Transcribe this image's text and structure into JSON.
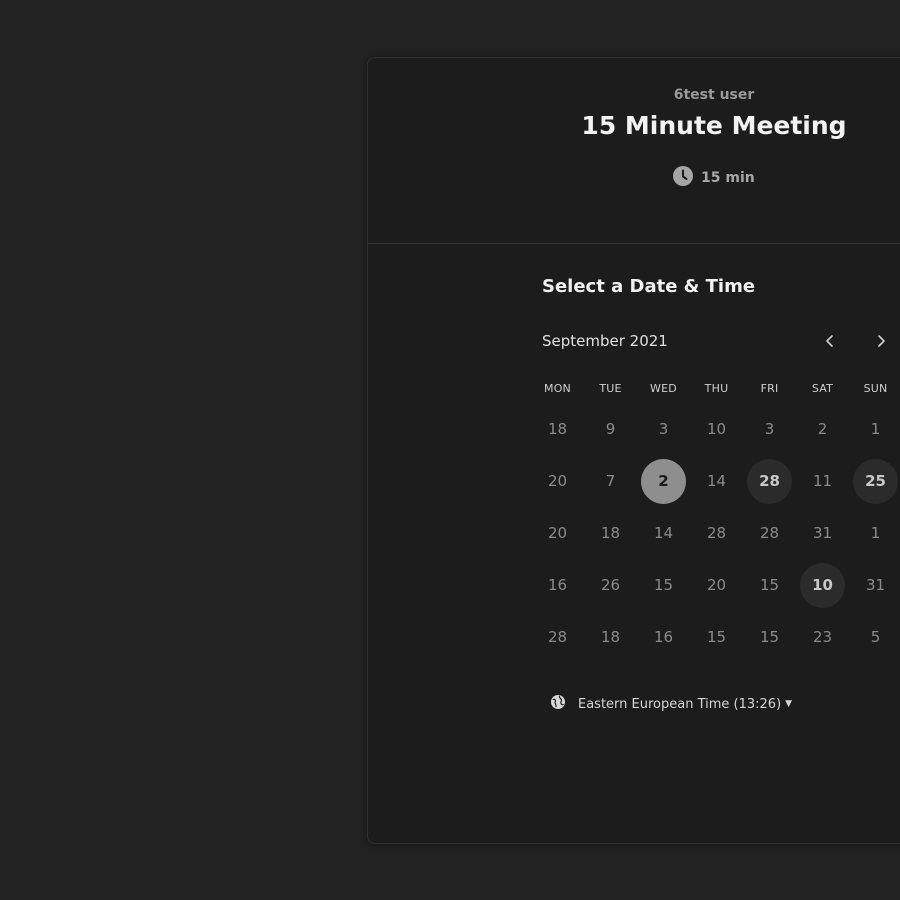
{
  "header": {
    "org_name": "6test user",
    "event_title": "15 Minute Meeting",
    "duration": "15 min"
  },
  "calendar": {
    "section_title": "Select a Date & Time",
    "month_label": "September 2021",
    "weekdays": [
      "MON",
      "TUE",
      "WED",
      "THU",
      "FRI",
      "SAT",
      "SUN"
    ],
    "days": [
      {
        "label": "18",
        "state": "unavailable"
      },
      {
        "label": "9",
        "state": "unavailable"
      },
      {
        "label": "3",
        "state": "unavailable"
      },
      {
        "label": "10",
        "state": "unavailable"
      },
      {
        "label": "3",
        "state": "unavailable"
      },
      {
        "label": "2",
        "state": "unavailable"
      },
      {
        "label": "1",
        "state": "unavailable"
      },
      {
        "label": "20",
        "state": "unavailable"
      },
      {
        "label": "7",
        "state": "unavailable"
      },
      {
        "label": "2",
        "state": "selected"
      },
      {
        "label": "14",
        "state": "unavailable"
      },
      {
        "label": "28",
        "state": "available"
      },
      {
        "label": "11",
        "state": "unavailable"
      },
      {
        "label": "25",
        "state": "available"
      },
      {
        "label": "20",
        "state": "unavailable"
      },
      {
        "label": "18",
        "state": "unavailable"
      },
      {
        "label": "14",
        "state": "unavailable"
      },
      {
        "label": "28",
        "state": "unavailable"
      },
      {
        "label": "28",
        "state": "unavailable"
      },
      {
        "label": "31",
        "state": "unavailable"
      },
      {
        "label": "1",
        "state": "unavailable"
      },
      {
        "label": "16",
        "state": "unavailable"
      },
      {
        "label": "26",
        "state": "unavailable"
      },
      {
        "label": "15",
        "state": "unavailable"
      },
      {
        "label": "20",
        "state": "unavailable"
      },
      {
        "label": "15",
        "state": "unavailable"
      },
      {
        "label": "10",
        "state": "available"
      },
      {
        "label": "31",
        "state": "unavailable"
      },
      {
        "label": "28",
        "state": "unavailable"
      },
      {
        "label": "18",
        "state": "unavailable"
      },
      {
        "label": "16",
        "state": "unavailable"
      },
      {
        "label": "15",
        "state": "unavailable"
      },
      {
        "label": "15",
        "state": "unavailable"
      },
      {
        "label": "23",
        "state": "unavailable"
      },
      {
        "label": "5",
        "state": "unavailable"
      }
    ]
  },
  "timezone": {
    "label": "Eastern European Time (13:26)",
    "icon": "globe-icon"
  },
  "colors": {
    "background": "#212121",
    "card": "#1c1c1c",
    "selected_day": "#8e8e8e",
    "available_day": "#2b2b2b"
  }
}
